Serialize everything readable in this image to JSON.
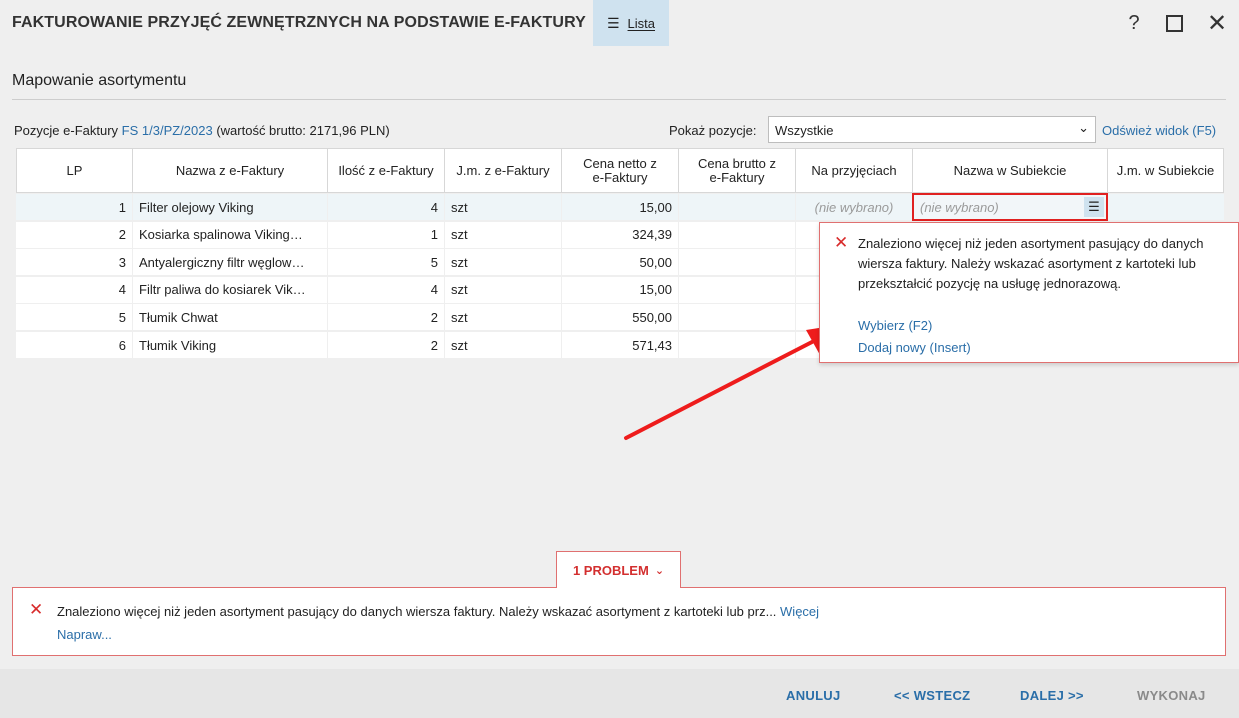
{
  "window": {
    "title": "FAKTUROWANIE PRZYJĘĆ ZEWNĘTRZNYCH NA PODSTAWIE E-FAKTURY",
    "lista_label": "Lista",
    "help_label": "?",
    "close_label": "✕"
  },
  "section": {
    "title": "Mapowanie asortymentu"
  },
  "info": {
    "prefix": "Pozycje e-Faktury ",
    "document_link": "FS 1/3/PZ/2023",
    "suffix": " (wartość brutto: 2171,96 PLN)"
  },
  "filter": {
    "label": "Pokaż pozycje:",
    "selected": "Wszystkie",
    "refresh_label": "Odśwież widok (F5)"
  },
  "table": {
    "headers": [
      "LP",
      "Nazwa z e-Faktury",
      "Ilość z e-Faktury",
      "J.m. z e-Faktury",
      "Cena netto z e-Faktury",
      "Cena brutto z e-Faktury",
      "Na przyjęciach",
      "Nazwa w Subiekcie",
      "J.m. w Subiekcie"
    ],
    "rows": [
      {
        "lp": "1",
        "name": "Filter olejowy Viking",
        "qty": "4",
        "unit": "szt",
        "net": "15,00",
        "gross": "",
        "na_przyjeciach": "(nie wybrano)",
        "name_sub": "(nie wybrano)",
        "unit_sub": ""
      },
      {
        "lp": "2",
        "name": "Kosiarka spalinowa Viking…",
        "qty": "1",
        "unit": "szt",
        "net": "324,39",
        "gross": "",
        "na_przyjeciach": "",
        "name_sub": "",
        "unit_sub": ""
      },
      {
        "lp": "3",
        "name": "Antyalergiczny filtr węglow…",
        "qty": "5",
        "unit": "szt",
        "net": "50,00",
        "gross": "",
        "na_przyjeciach": "",
        "name_sub": "",
        "unit_sub": ""
      },
      {
        "lp": "4",
        "name": "Filtr paliwa do kosiarek Vik…",
        "qty": "4",
        "unit": "szt",
        "net": "15,00",
        "gross": "",
        "na_przyjeciach": "",
        "name_sub": "",
        "unit_sub": ""
      },
      {
        "lp": "5",
        "name": "Tłumik Chwat",
        "qty": "2",
        "unit": "szt",
        "net": "550,00",
        "gross": "",
        "na_przyjeciach": "",
        "name_sub": "",
        "unit_sub": ""
      },
      {
        "lp": "6",
        "name": "Tłumik Viking",
        "qty": "2",
        "unit": "szt",
        "net": "571,43",
        "gross": "",
        "na_przyjeciach": "",
        "name_sub": "",
        "unit_sub": ""
      }
    ]
  },
  "popup": {
    "message": "Znaleziono więcej niż jeden asortyment pasujący do danych wiersza faktury. Należy wskazać asortyment z kartoteki lub przekształcić pozycję na usługę jednorazową.",
    "choose_label": "Wybierz (F2)",
    "add_label": "Dodaj nowy (Insert)"
  },
  "problems": {
    "tab_label": "1 PROBLEM",
    "message": "Znaleziono więcej niż jeden asortyment pasujący do danych wiersza faktury. Należy wskazać asortyment z kartoteki lub prz... ",
    "more_label": "Więcej",
    "fix_label": "Napraw..."
  },
  "footer": {
    "cancel": "ANULUJ",
    "back": "<< WSTECZ",
    "next": "DALEJ >>",
    "execute": "WYKONAJ"
  },
  "colors": {
    "link": "#2a6ea8",
    "error": "#d82b2b",
    "accent_bg": "#cfe2ef"
  }
}
